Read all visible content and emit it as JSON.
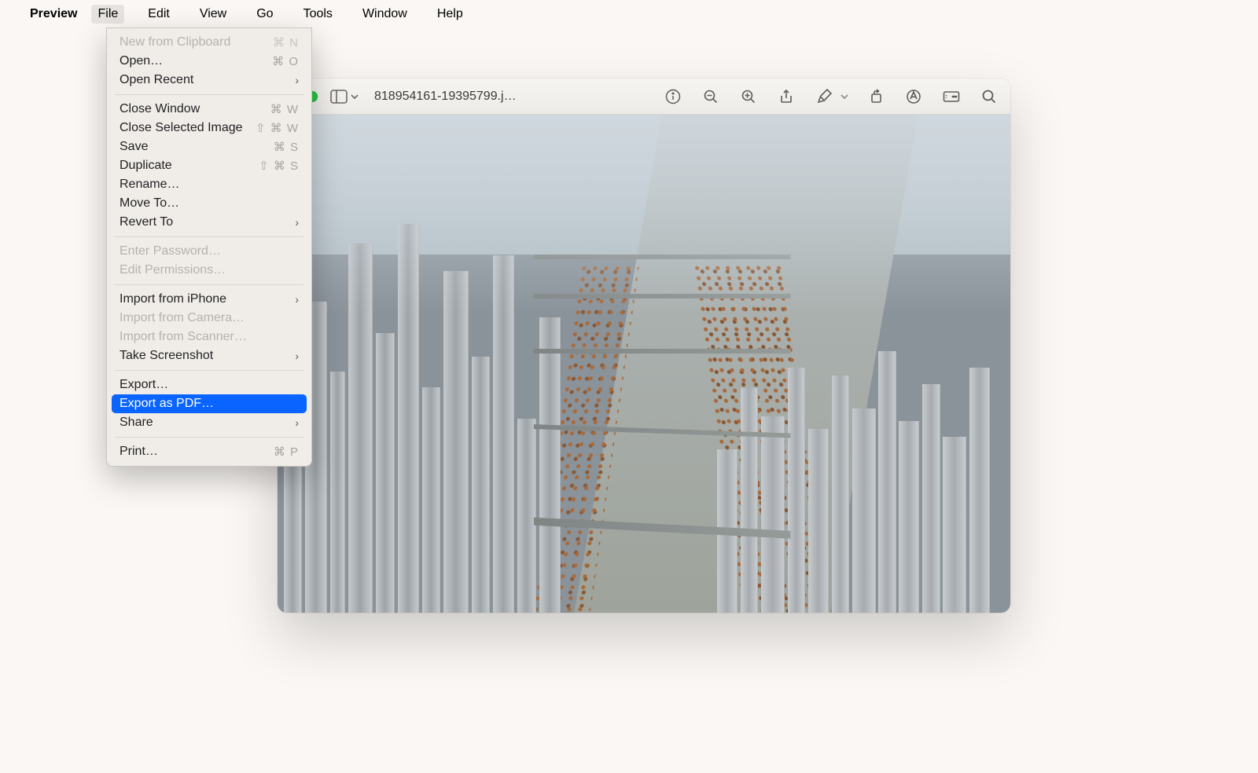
{
  "menubar": {
    "app_name": "Preview",
    "items": [
      "File",
      "Edit",
      "View",
      "Go",
      "Tools",
      "Window",
      "Help"
    ],
    "open_index": 0
  },
  "file_menu": {
    "items": [
      {
        "label": "New from Clipboard",
        "shortcut": "⌘ N",
        "disabled": true
      },
      {
        "label": "Open…",
        "shortcut": "⌘ O"
      },
      {
        "label": "Open Recent",
        "submenu": true
      },
      {
        "sep": true
      },
      {
        "label": "Close Window",
        "shortcut": "⌘ W"
      },
      {
        "label": "Close Selected Image",
        "shortcut": "⇧ ⌘ W"
      },
      {
        "label": "Save",
        "shortcut": "⌘ S"
      },
      {
        "label": "Duplicate",
        "shortcut": "⇧ ⌘ S"
      },
      {
        "label": "Rename…"
      },
      {
        "label": "Move To…"
      },
      {
        "label": "Revert To",
        "submenu": true
      },
      {
        "sep": true
      },
      {
        "label": "Enter Password…",
        "disabled": true
      },
      {
        "label": "Edit Permissions…",
        "disabled": true
      },
      {
        "sep": true
      },
      {
        "label": "Import from iPhone",
        "submenu": true
      },
      {
        "label": "Import from Camera…",
        "disabled": true
      },
      {
        "label": "Import from Scanner…",
        "disabled": true
      },
      {
        "label": "Take Screenshot",
        "submenu": true
      },
      {
        "sep": true
      },
      {
        "label": "Export…"
      },
      {
        "label": "Export as PDF…",
        "highlight": true
      },
      {
        "label": "Share",
        "submenu": true
      },
      {
        "sep": true
      },
      {
        "label": "Print…",
        "shortcut": "⌘ P"
      }
    ]
  },
  "window": {
    "title": "818954161-19395799.j…"
  }
}
